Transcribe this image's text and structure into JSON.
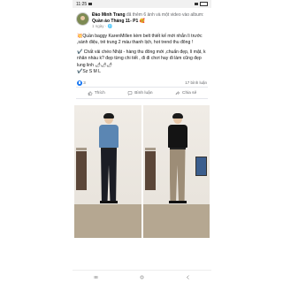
{
  "status": {
    "time": "11:25"
  },
  "post": {
    "author": "Đào Minh Trang",
    "action_text": "đã thêm 6 ảnh và một video vào album:",
    "album": "Quần áo Tháng 11- P1",
    "time": "1 ngày",
    "body": [
      "💥Quần baggy KarenMillen kèm belt thiết kế mới nhắn lì trước ,sành điệu, trẻ trung 2 màu thanh lịch, hot trend thu đông !",
      "✔️ Chất vải chéo Nhật - hàng thu đông mới ,chuẩn đẹp, lì mặt, k nhăn nhàu k? đẹp từng chi tiết , đi đi chơi hay đi làm cũng đẹp lung linh 🌶🌶🌶\n✔️Sz S M L"
    ],
    "reaction_count": "3",
    "comment_count": "17 bình luận"
  },
  "actions": {
    "like": "Thích",
    "comment": "Bình luận",
    "share": "Chia sẻ"
  },
  "icons": {
    "like": "thumbs-up-icon",
    "comment": "comment-icon",
    "share": "share-icon",
    "nav_menu": "recent-apps-icon",
    "nav_home": "home-icon",
    "nav_back": "back-icon"
  },
  "colors": {
    "accent": "#1877f2",
    "photo1_top": "#5b86b3",
    "photo1_pants": "#1b1d25",
    "photo2_top": "#141414",
    "photo2_pants": "#9d8d77"
  }
}
